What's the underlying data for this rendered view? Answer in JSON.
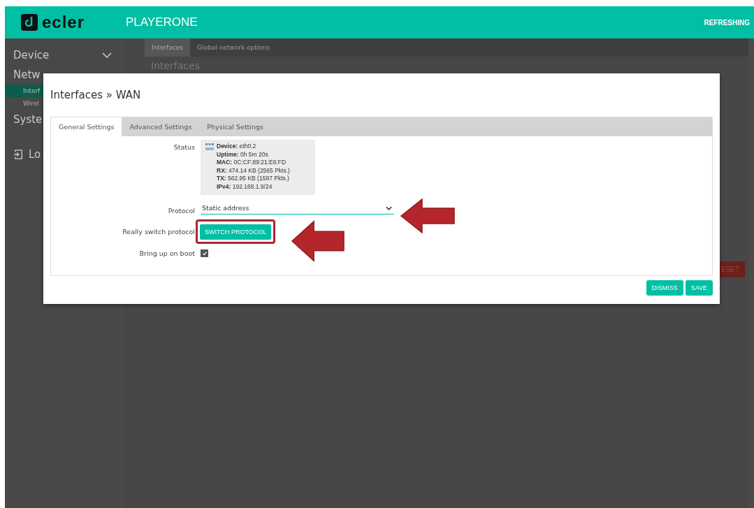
{
  "header": {
    "brand": "ecler",
    "product": "PLAYERONE",
    "status": "REFRESHING"
  },
  "sidebar": {
    "items": [
      {
        "label": "Device",
        "kind": "group",
        "expanded": false,
        "selected": false
      },
      {
        "label": "Netw",
        "kind": "group",
        "selected": false
      },
      {
        "label": "Interf",
        "kind": "sub",
        "selected": true
      },
      {
        "label": "Wirel",
        "kind": "sub",
        "selected": false
      },
      {
        "label": "Syste",
        "kind": "group",
        "selected": false
      },
      {
        "label": "Lo",
        "kind": "logout",
        "selected": false
      }
    ]
  },
  "page_tabs": [
    {
      "label": "Interfaces",
      "selected": true
    },
    {
      "label": "Global network options",
      "selected": false
    }
  ],
  "page_heading": "Interfaces",
  "background_button": "ESET",
  "modal": {
    "title": "Interfaces » WAN",
    "tabs": [
      {
        "label": "General Settings",
        "selected": true
      },
      {
        "label": "Advanced Settings",
        "selected": false
      },
      {
        "label": "Physical Settings",
        "selected": false
      }
    ],
    "status": {
      "label": "Status",
      "lines": [
        "**Device:** eth0.2",
        "**Uptime:** 0h 5m 20s",
        "**MAC:** 0C:CF:89:21:E6:FD",
        "**RX:** 474.14 KB (2565 Pkts.)",
        "**TX:** 562.95 KB (1587 Pkts.)",
        "**IPv4:** 192.168.1.9/24"
      ]
    },
    "protocol": {
      "label": "Protocol",
      "value": "Static address"
    },
    "switch": {
      "label": "Really switch protocol",
      "button": "SWITCH PROTOCOL",
      "highlighted": true
    },
    "boot": {
      "label": "Bring up on boot",
      "checked": true
    },
    "buttons": [
      "DISMISS",
      "SAVE"
    ]
  }
}
